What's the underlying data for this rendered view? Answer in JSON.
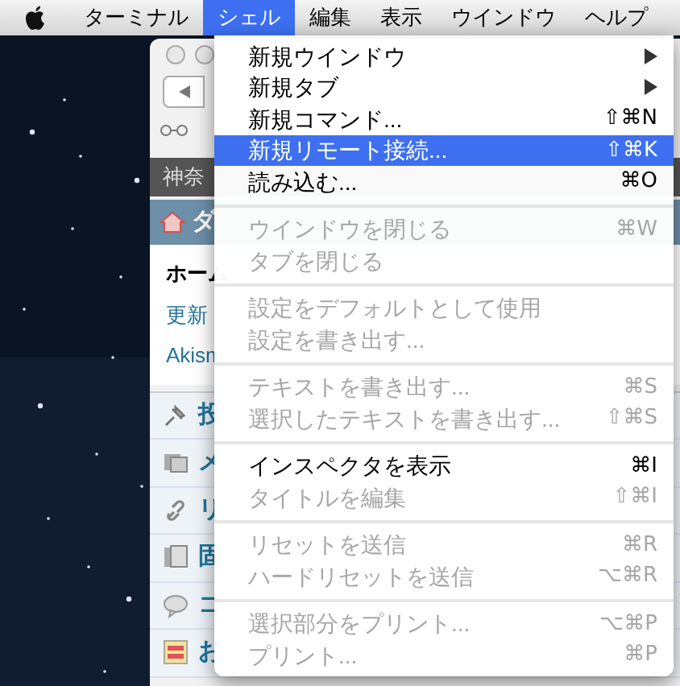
{
  "menubar": {
    "items": [
      {
        "label": "ターミナル",
        "selected": false
      },
      {
        "label": "シェル",
        "selected": true
      },
      {
        "label": "編集",
        "selected": false
      },
      {
        "label": "表示",
        "selected": false
      },
      {
        "label": "ウインドウ",
        "selected": false
      },
      {
        "label": "ヘルプ",
        "selected": false
      }
    ]
  },
  "browser": {
    "tab_label": "神奈",
    "header_label": "ダ",
    "links": [
      {
        "label": "ホーム",
        "kind": "heading"
      },
      {
        "label": "更新",
        "kind": "link"
      },
      {
        "label": "Akism",
        "kind": "link"
      }
    ],
    "sidebar": [
      {
        "label": "投"
      },
      {
        "label": "メ"
      },
      {
        "label": "リ"
      },
      {
        "label": "固"
      },
      {
        "label": "コ"
      },
      {
        "label": "お"
      }
    ]
  },
  "menu": {
    "items": [
      {
        "kind": "item",
        "label": "新規ウインドウ",
        "submenu": true,
        "disabled": false,
        "selected": false
      },
      {
        "kind": "item",
        "label": "新規タブ",
        "submenu": true,
        "disabled": false,
        "selected": false
      },
      {
        "kind": "item",
        "label": "新規コマンド...",
        "shortcut": "⇧⌘N",
        "disabled": false,
        "selected": false
      },
      {
        "kind": "item",
        "label": "新規リモート接続...",
        "shortcut": "⇧⌘K",
        "disabled": false,
        "selected": true
      },
      {
        "kind": "item",
        "label": "読み込む...",
        "shortcut": "⌘O",
        "disabled": false,
        "selected": false
      },
      {
        "kind": "separator"
      },
      {
        "kind": "item",
        "label": "ウインドウを閉じる",
        "shortcut": "⌘W",
        "disabled": true,
        "selected": false
      },
      {
        "kind": "item",
        "label": "タブを閉じる",
        "disabled": true,
        "selected": false
      },
      {
        "kind": "separator"
      },
      {
        "kind": "item",
        "label": "設定をデフォルトとして使用",
        "disabled": true,
        "selected": false
      },
      {
        "kind": "item",
        "label": "設定を書き出す...",
        "disabled": true,
        "selected": false
      },
      {
        "kind": "separator"
      },
      {
        "kind": "item",
        "label": "テキストを書き出す...",
        "shortcut": "⌘S",
        "disabled": true,
        "selected": false
      },
      {
        "kind": "item",
        "label": "選択したテキストを書き出す...",
        "shortcut": "⇧⌘S",
        "disabled": true,
        "selected": false
      },
      {
        "kind": "separator"
      },
      {
        "kind": "item",
        "label": "インスペクタを表示",
        "shortcut": "⌘I",
        "disabled": false,
        "selected": false
      },
      {
        "kind": "item",
        "label": "タイトルを編集",
        "shortcut": "⇧⌘I",
        "disabled": true,
        "selected": false
      },
      {
        "kind": "separator"
      },
      {
        "kind": "item",
        "label": "リセットを送信",
        "shortcut": "⌘R",
        "disabled": true,
        "selected": false
      },
      {
        "kind": "item",
        "label": "ハードリセットを送信",
        "shortcut": "⌥⌘R",
        "disabled": true,
        "selected": false
      },
      {
        "kind": "separator"
      },
      {
        "kind": "item",
        "label": "選択部分をプリント...",
        "shortcut": "⌥⌘P",
        "disabled": true,
        "selected": false
      },
      {
        "kind": "item",
        "label": "プリント...",
        "shortcut": "⌘P",
        "disabled": true,
        "selected": false
      }
    ]
  }
}
